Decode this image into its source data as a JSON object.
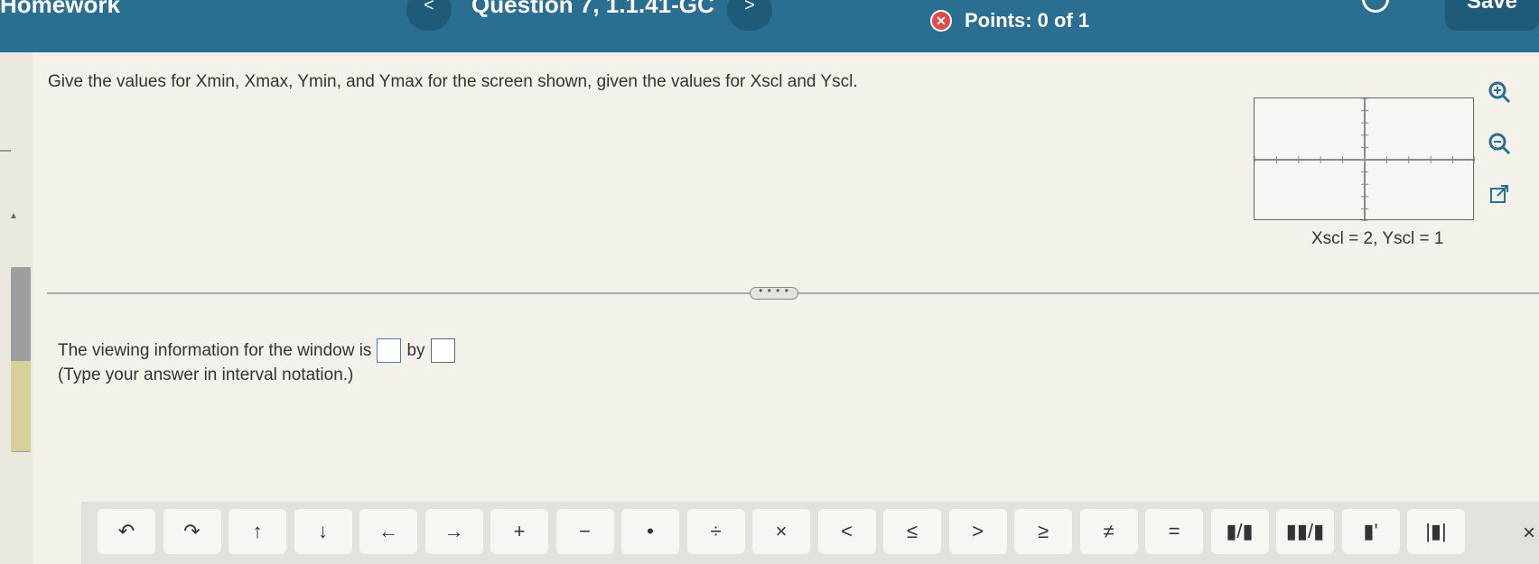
{
  "header": {
    "app_title": "Homework",
    "question_title": "Question 7, 1.1.41-GC",
    "prev_label": "<",
    "next_label": ">",
    "points_label": "Points: 0 of 1",
    "save_label": "Save"
  },
  "question": {
    "prompt": "Give the values for Xmin, Xmax, Ymin, and Ymax for the screen shown, given the values for Xscl and Yscl.",
    "scale_label": "Xscl = 2, Yscl = 1"
  },
  "answer": {
    "lead_text": "The viewing information for the window is",
    "connector": "by",
    "hint": "(Type your answer in interval notation.)",
    "first_value": "",
    "second_value": ""
  },
  "toolbar": {
    "buttons": [
      "↶",
      "↷",
      "↑",
      "↓",
      "←",
      "→",
      "+",
      "−",
      "•",
      "÷",
      "×",
      "<",
      "≤",
      ">",
      "≥",
      "≠",
      "=",
      "▮/▮",
      "▮▮/▮",
      "▮'",
      "|▮|"
    ],
    "close_label": "×"
  },
  "icons": {
    "zoom_in": "zoom-in-icon",
    "zoom_out": "zoom-out-icon",
    "popout": "external-link-icon"
  },
  "colors": {
    "header": "#2a6f92",
    "accent": "#4a7fb5",
    "error": "#e24a4a"
  }
}
